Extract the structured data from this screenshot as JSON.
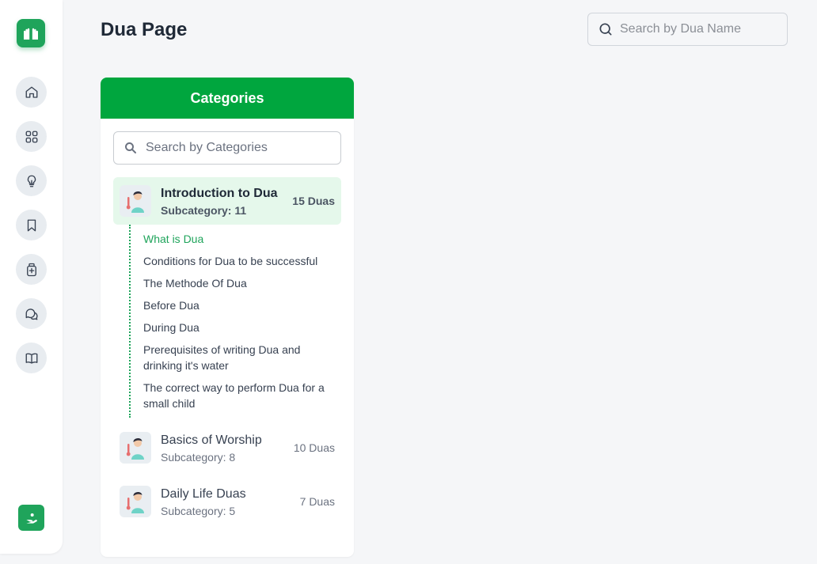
{
  "header": {
    "title": "Dua Page",
    "search_placeholder": "Search by Dua Name"
  },
  "sidebar": {
    "logo_icon": "praying-hands-icon",
    "items": [
      {
        "icon": "home-icon"
      },
      {
        "icon": "grid-icon"
      },
      {
        "icon": "lightbulb-icon"
      },
      {
        "icon": "bookmark-icon"
      },
      {
        "icon": "medicine-icon"
      },
      {
        "icon": "chat-icon"
      },
      {
        "icon": "book-icon"
      }
    ],
    "bottom_icon": "hand-donate-icon"
  },
  "categories": {
    "title": "Categories",
    "search_placeholder": "Search by Categories",
    "list": [
      {
        "name": "Introduction to Dua",
        "subcategory": "Subcategory: 11",
        "count": "15 Duas",
        "active": true
      },
      {
        "name": "Basics of Worship",
        "subcategory": "Subcategory: 8",
        "count": "10 Duas",
        "active": false
      },
      {
        "name": "Daily Life Duas",
        "subcategory": "Subcategory: 5",
        "count": "7 Duas",
        "active": false
      }
    ],
    "subitems": [
      "What is Dua",
      "Conditions for Dua to be successful",
      "The Methode Of Dua",
      "Before Dua",
      "During Dua",
      "Prerequisites of writing Dua and drinking it's water",
      "The correct way to perform Dua for a small child"
    ]
  },
  "colors": {
    "accent": "#00a63e",
    "active_bg": "#e5f8eb"
  }
}
